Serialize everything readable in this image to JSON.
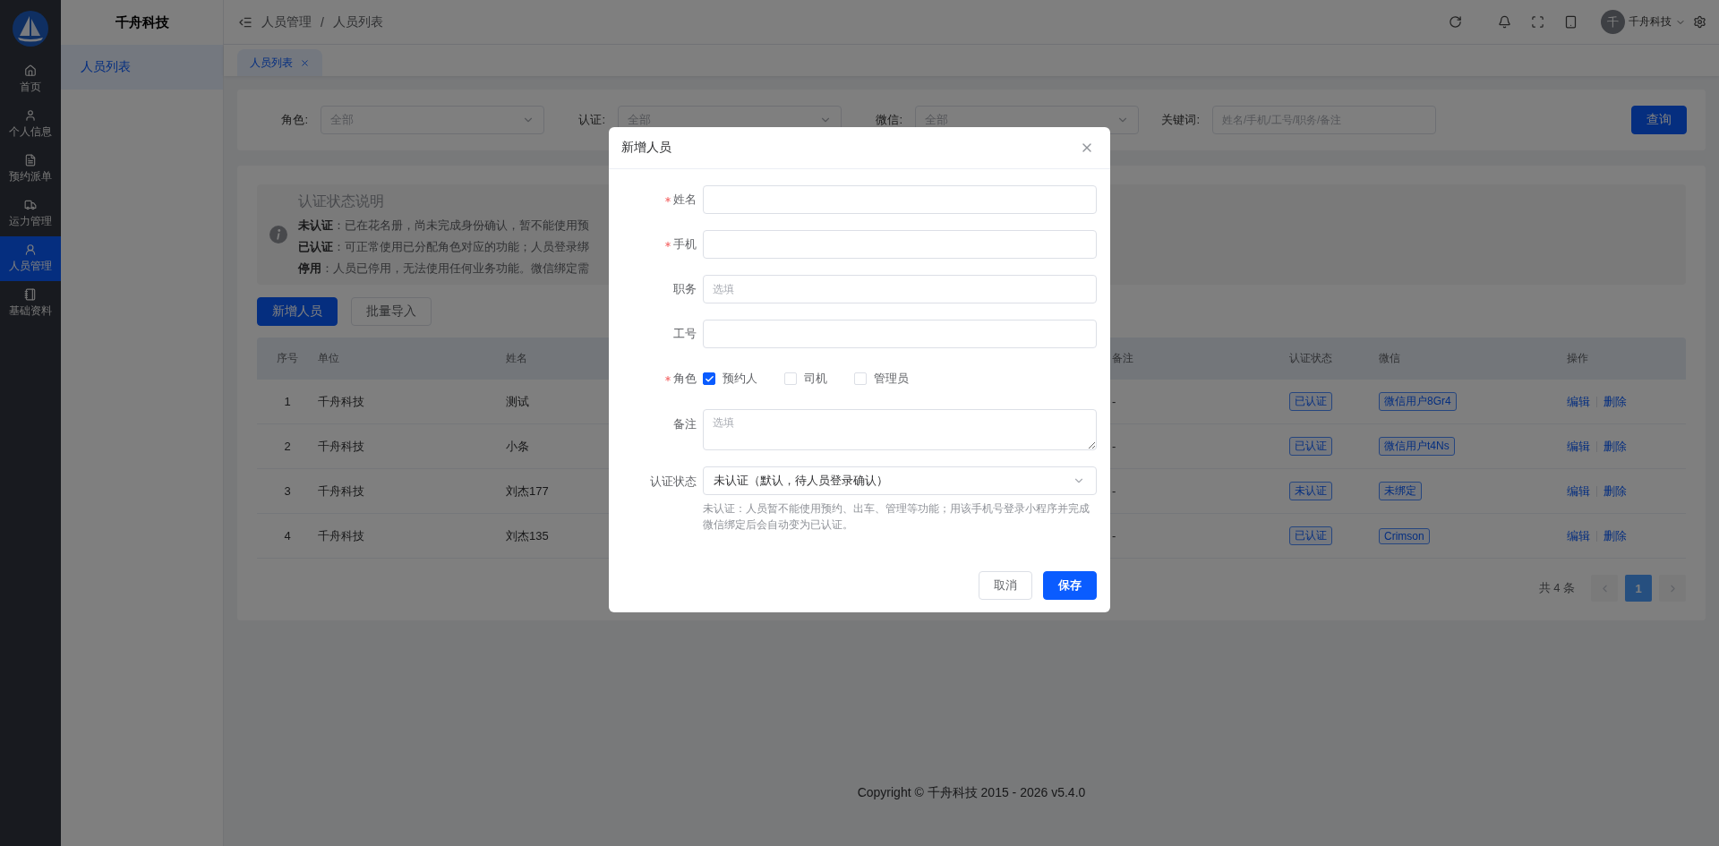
{
  "nav_rail": [
    {
      "label": "首页",
      "selected": false
    },
    {
      "label": "个人信息",
      "selected": false
    },
    {
      "label": "预约派单",
      "selected": false
    },
    {
      "label": "运力管理",
      "selected": false
    },
    {
      "label": "人员管理",
      "selected": true
    },
    {
      "label": "基础资料",
      "selected": false
    }
  ],
  "sub_nav": {
    "title": "千舟科技",
    "items": [
      {
        "label": "人员列表",
        "selected": true
      }
    ]
  },
  "header": {
    "breadcrumb": {
      "items": [
        "人员管理",
        "人员列表"
      ],
      "separator": "/"
    },
    "user": {
      "avatar": "千",
      "name": "千舟科技"
    }
  },
  "page_tabs": [
    {
      "label": "人员列表",
      "selected": true
    }
  ],
  "filters": [
    {
      "kind": "select",
      "label": "角色:",
      "placeholder": "全部"
    },
    {
      "kind": "select",
      "label": "认证:",
      "placeholder": "全部"
    },
    {
      "kind": "select",
      "label": "微信:",
      "placeholder": "全部"
    },
    {
      "kind": "input",
      "label": "关键词:",
      "placeholder": "姓名/手机/工号/职务/备注"
    }
  ],
  "search_button": "查询",
  "notice": {
    "title": "认证状态说明",
    "lines": [
      "**未认证**：已在花名册，尚未完成身份确认，暂不能使用预",
      "**已认证**：可正常使用已分配角色对应的功能；人员登录绑",
      "**停用**：人员已停用，无法使用任何业务功能。微信绑定需"
    ]
  },
  "actions": [
    {
      "kind": "primary",
      "label": "新增人员"
    },
    {
      "kind": "default",
      "label": "批量导入"
    }
  ],
  "table": {
    "columns": [
      "序号",
      "单位",
      "姓名",
      "备注",
      "认证状态",
      "微信",
      "操作"
    ],
    "rows": [
      {
        "index": "1",
        "unit": "千舟科技",
        "name": "测试",
        "remark": "-",
        "status": "已认证",
        "wechat": "微信用户8Gr4",
        "actions": [
          "编辑",
          "删除"
        ]
      },
      {
        "index": "2",
        "unit": "千舟科技",
        "name": "小条",
        "remark": "-",
        "status": "已认证",
        "wechat": "微信用户t4Ns",
        "actions": [
          "编辑",
          "删除"
        ]
      },
      {
        "index": "3",
        "unit": "千舟科技",
        "name": "刘杰177",
        "remark": "-",
        "status": "未认证",
        "wechat": "未绑定",
        "actions": [
          "编辑",
          "删除"
        ]
      },
      {
        "index": "4",
        "unit": "千舟科技",
        "name": "刘杰135",
        "remark": "-",
        "status": "已认证",
        "wechat": "Crimson",
        "actions": [
          "编辑",
          "删除"
        ]
      }
    ]
  },
  "pagination": {
    "total": "共 4 条",
    "pages": [
      {
        "label": "1",
        "selected": true
      }
    ]
  },
  "footer": "Copyright © 千舟科技 2015 - 2026 v5.4.0",
  "dialog": {
    "title": "新增人员",
    "fields": [
      {
        "kind": "input",
        "label": "姓名",
        "required": true
      },
      {
        "kind": "input",
        "label": "手机",
        "required": true
      },
      {
        "kind": "input",
        "label": "职务",
        "required": false,
        "placeholder": "选填"
      },
      {
        "kind": "input",
        "label": "工号",
        "required": false
      },
      {
        "kind": "checkboxes",
        "label": "角色",
        "required": true,
        "options": [
          {
            "label": "预约人",
            "checked": true
          },
          {
            "label": "司机",
            "checked": false
          },
          {
            "label": "管理员",
            "checked": false
          }
        ]
      },
      {
        "kind": "textarea",
        "label": "备注",
        "required": false,
        "placeholder": "选填"
      },
      {
        "kind": "select",
        "label": "认证状态",
        "required": false,
        "value": "未认证（默认，待人员登录确认）",
        "help": "未认证：人员暂不能使用预约、出车、管理等功能；用该手机号登录小程序并完成微信绑定后会自动变为已认证。"
      }
    ],
    "buttons": [
      {
        "kind": "default",
        "label": "取消"
      },
      {
        "kind": "primary",
        "label": "保存"
      }
    ]
  }
}
